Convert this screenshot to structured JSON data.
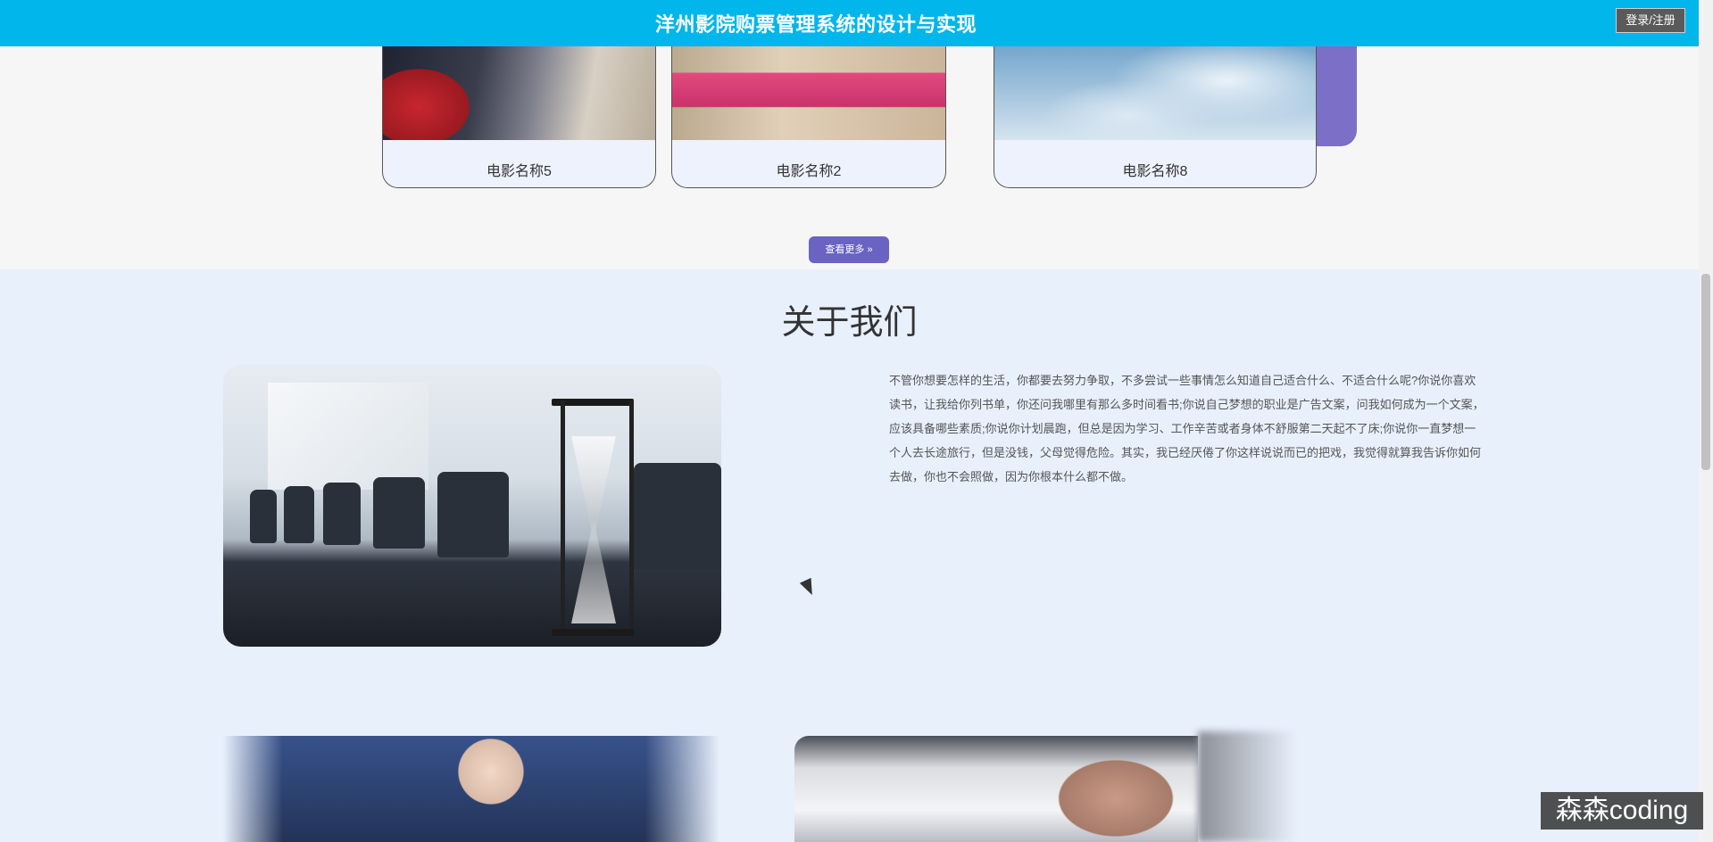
{
  "header": {
    "title": "洋州影院购票管理系统的设计与实现",
    "login_label": "登录/注册"
  },
  "movies": {
    "items": [
      {
        "name": "电影名称5"
      },
      {
        "name": "电影名称2"
      },
      {
        "name": "电影名称8"
      }
    ],
    "more_label": "查看更多 »"
  },
  "about": {
    "title": "关于我们",
    "text": "不管你想要怎样的生活，你都要去努力争取，不多尝试一些事情怎么知道自己适合什么、不适合什么呢?你说你喜欢读书，让我给你列书单，你还问我哪里有那么多时间看书;你说自己梦想的职业是广告文案，问我如何成为一个文案，应该具备哪些素质;你说你计划晨跑，但总是因为学习、工作辛苦或者身体不舒服第二天起不了床;你说你一直梦想一个人去长途旅行，但是没钱，父母觉得危险。其实，我已经厌倦了你这样说说而已的把戏，我觉得就算我告诉你如何去做，你也不会照做，因为你根本什么都不做。"
  },
  "watermark": "森森coding",
  "colors": {
    "header_bg": "#01b6ea",
    "accent_purple": "#6b63c1",
    "page_bg": "#e8f0fc"
  }
}
